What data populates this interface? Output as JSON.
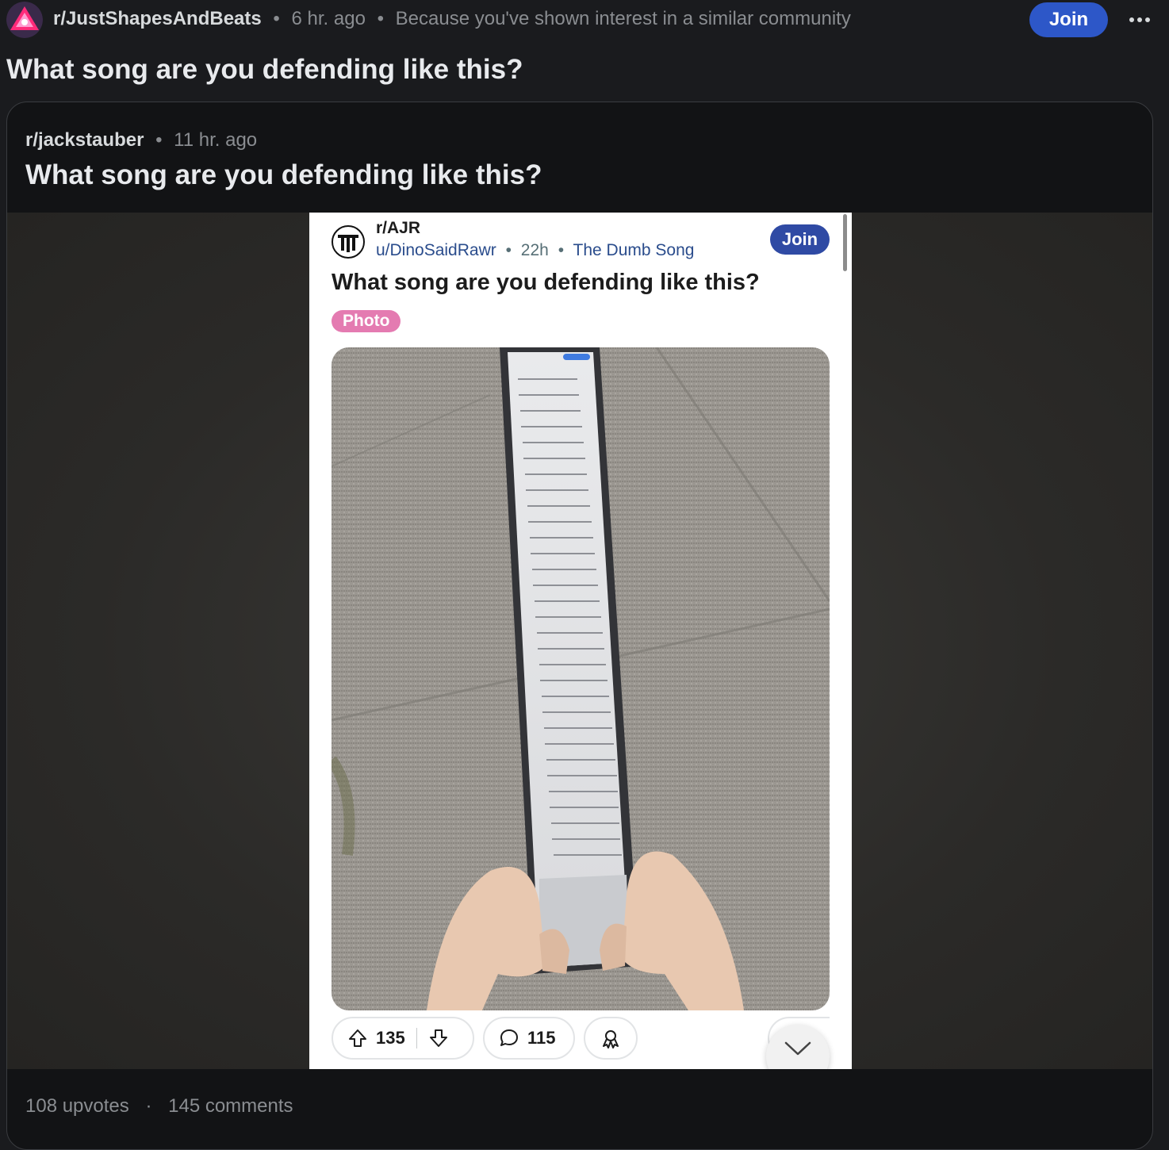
{
  "header": {
    "subreddit": "r/JustShapesAndBeats",
    "time": "6 hr. ago",
    "reason": "Because you've shown interest in a similar community",
    "join_label": "Join",
    "more_icon": "more-horizontal-icon"
  },
  "post": {
    "title": "What song are you defending like this?"
  },
  "crosspost": {
    "subreddit": "r/jackstauber",
    "time": "11 hr. ago",
    "title": "What song are you defending like this?"
  },
  "screenshot": {
    "subreddit": "r/AJR",
    "user": "u/DinoSaidRawr",
    "time": "22h",
    "flair": "The Dumb Song",
    "join_label": "Join",
    "title": "What song are you defending like this?",
    "tag": "Photo",
    "upvotes": "135",
    "comments": "115",
    "colors": {
      "join": "#2f4aa4",
      "tag": "#e47bb1",
      "link": "#2a4c8c"
    }
  },
  "footer": {
    "upvotes": "108 upvotes",
    "comments": "145 comments"
  },
  "colors": {
    "background": "#1a1b1e",
    "join_button": "#2d57c8"
  }
}
